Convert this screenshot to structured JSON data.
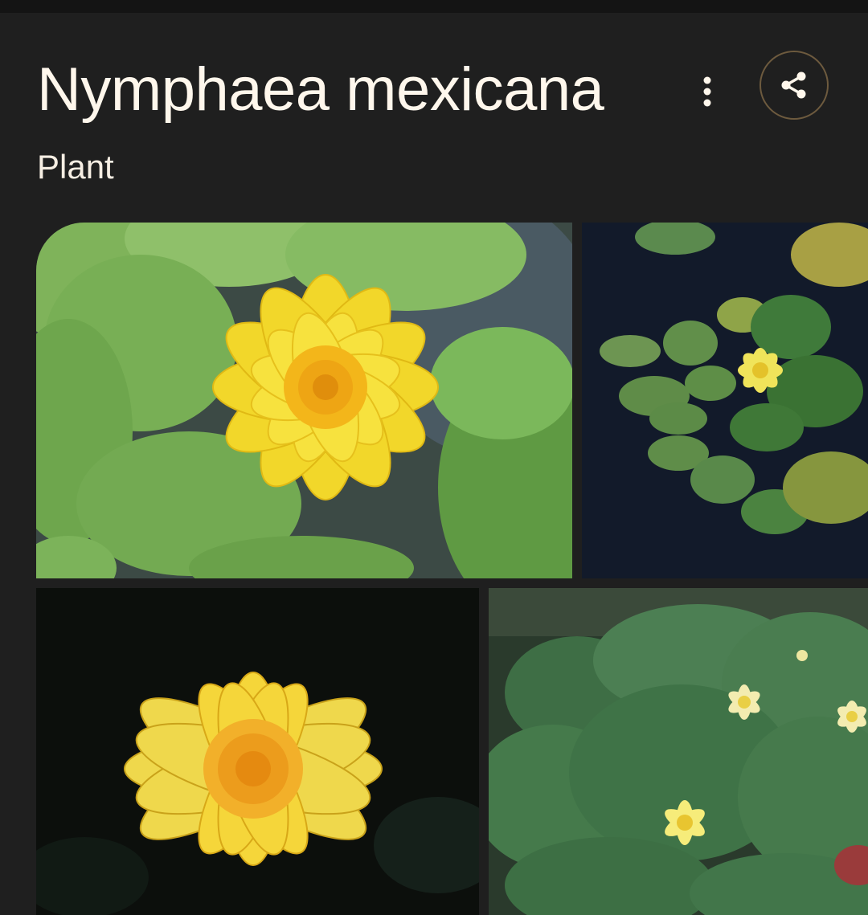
{
  "header": {
    "title": "Nymphaea mexicana",
    "subtitle": "Plant"
  },
  "actions": {
    "more_icon": "more-vert-icon",
    "share_icon": "share-icon"
  },
  "colors": {
    "background": "#1f1f1f",
    "title_text": "#fff7ec",
    "share_ring": "#6d5a3e"
  }
}
